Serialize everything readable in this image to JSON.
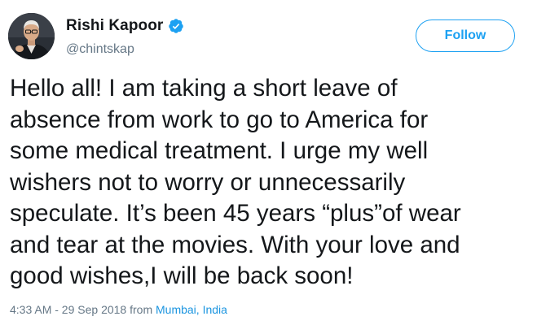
{
  "user": {
    "display_name": "Rishi Kapoor",
    "handle": "@chintskap",
    "verified": true
  },
  "follow_button": {
    "label": "Follow"
  },
  "tweet": {
    "text": "Hello all! I am taking a short leave of\nabsence from work to go to America for\nsome medical treatment. I urge my well\nwishers not to worry or unnecessarily\nspeculate. It’s been 45 years “plus”of wear\nand tear at the movies. With your love and\ngood wishes,I  will be back soon!"
  },
  "meta": {
    "timestamp": "4:33 AM - 29 Sep 2018",
    "from_text": "from",
    "location_city": "Mumbai",
    "location_sep": ",",
    "location_country": "India"
  },
  "colors": {
    "accent": "#1da1f2",
    "link": "#1b95e0",
    "secondary_text": "#657786",
    "primary_text": "#14171a"
  },
  "icons": {
    "verified": "verified-badge-icon",
    "avatar": "profile-photo"
  }
}
